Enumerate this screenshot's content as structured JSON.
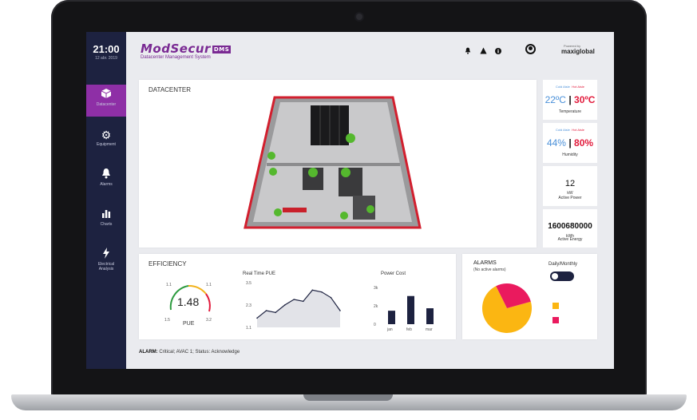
{
  "sidebar": {
    "time": "21:00",
    "date": "12 abr. 2019",
    "items": [
      {
        "label": "Datacenter",
        "icon": "cube-icon"
      },
      {
        "label": "Equipment",
        "icon": "gear-icon"
      },
      {
        "label": "Alarms",
        "icon": "bell-icon"
      },
      {
        "label": "Charts",
        "icon": "bar-chart-icon"
      },
      {
        "label": "Electrical Analysis",
        "icon": "lightning-icon"
      }
    ]
  },
  "header": {
    "logo": "ModSecur",
    "logo_tag": "DMS",
    "subtitle": "Datacenter Management System",
    "powered_by": "Powered by",
    "brand": "maxiglobal"
  },
  "datacenter": {
    "title": "DATACENTER"
  },
  "stats": {
    "temperature": {
      "cold_label": "Cold Aisle",
      "hot_label": "Hot Aisle",
      "cold": "22ºC",
      "hot": "30ºC",
      "label": "Temperature"
    },
    "humidity": {
      "cold_label": "Cold Aisle",
      "hot_label": "Hot Aisle",
      "cold": "44%",
      "hot": "80%",
      "label": "Humidity"
    },
    "power": {
      "value": "12",
      "unit": "kW",
      "label": "Active Power"
    },
    "energy": {
      "value": "1600680000",
      "unit": "kWh",
      "label": "Active Energy"
    }
  },
  "efficiency": {
    "title": "EFFICIENCY",
    "pue_value": "1.48",
    "pue_label": "PUE",
    "gauge_ticks": [
      "1.1",
      "1.1",
      "1.5",
      "3.2"
    ],
    "realtime_title": "Real Time PUE",
    "power_cost_title": "Power Cost"
  },
  "alarms": {
    "title": "ALARMS",
    "subtitle": "(No active alarms)",
    "toggle_label": "Daily/Monthly"
  },
  "status_bar": {
    "prefix": "ALARM:",
    "text": "Critical; AVAC 1; Status: Acknowledge"
  },
  "colors": {
    "accent": "#8e2fa6",
    "sidebar": "#1d2240",
    "hot": "#e21b3c",
    "cold": "#4a90d9",
    "pie_yellow": "#fbb612",
    "pie_pink": "#ea1a5e"
  },
  "chart_data": [
    {
      "type": "line",
      "title": "Real Time PUE",
      "ylim": [
        1.1,
        3.5
      ],
      "yticks": [
        "3.5",
        "2.3",
        "1.1"
      ],
      "x": [
        0,
        1,
        2,
        3,
        4,
        5,
        6,
        7,
        8,
        9
      ],
      "values": [
        1.6,
        2.0,
        1.9,
        2.3,
        2.6,
        2.5,
        3.1,
        3.0,
        2.7,
        2.0
      ],
      "grid": false
    },
    {
      "type": "bar",
      "title": "Power Cost",
      "categories": [
        "jan",
        "feb",
        "mar"
      ],
      "values": [
        1.1,
        2.3,
        1.3
      ],
      "yticks": [
        "3k",
        "2k",
        "0"
      ],
      "ylim": [
        0,
        3
      ]
    },
    {
      "type": "pie",
      "labels": [
        "",
        ""
      ],
      "values": [
        72,
        28
      ],
      "colors": [
        "#fbb612",
        "#ea1a5e"
      ]
    }
  ]
}
